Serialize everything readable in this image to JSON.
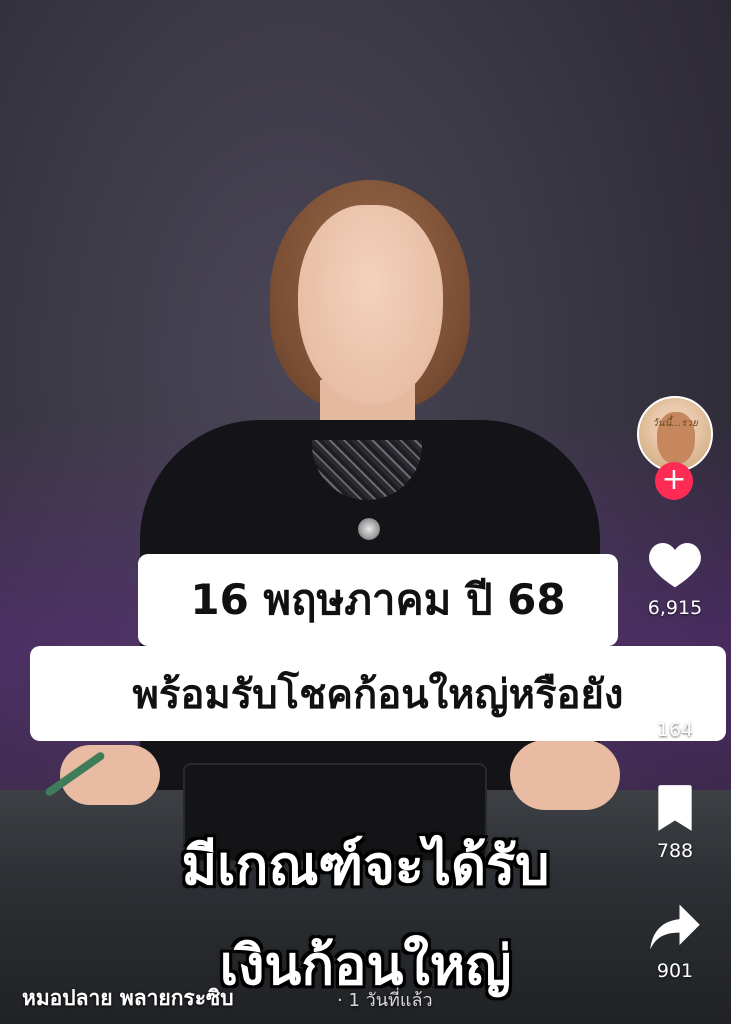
{
  "video": {
    "caption_line1": "16 พฤษภาคม ปี 68",
    "caption_line2": "พร้อมรับโชคก้อนใหญ่หรือยัง",
    "overlay_line1": "มีเกณฑ์จะได้รับ",
    "overlay_line2": "เงินก้อนใหญ่"
  },
  "creator": {
    "name": "หมอปลาย พลายกระซิบ",
    "time": "· 1 วันที่แล้ว",
    "avatar_text": "วันนี้...รวย",
    "follow_symbol": "+"
  },
  "actions": {
    "likes": "6,915",
    "comments": "164",
    "saves": "788",
    "shares": "901"
  },
  "colors": {
    "follow": "#fe2c55",
    "caption_bg": "#ffffff"
  },
  "icons": [
    "heart-icon",
    "comment-icon",
    "bookmark-icon",
    "share-icon",
    "plus-icon"
  ]
}
